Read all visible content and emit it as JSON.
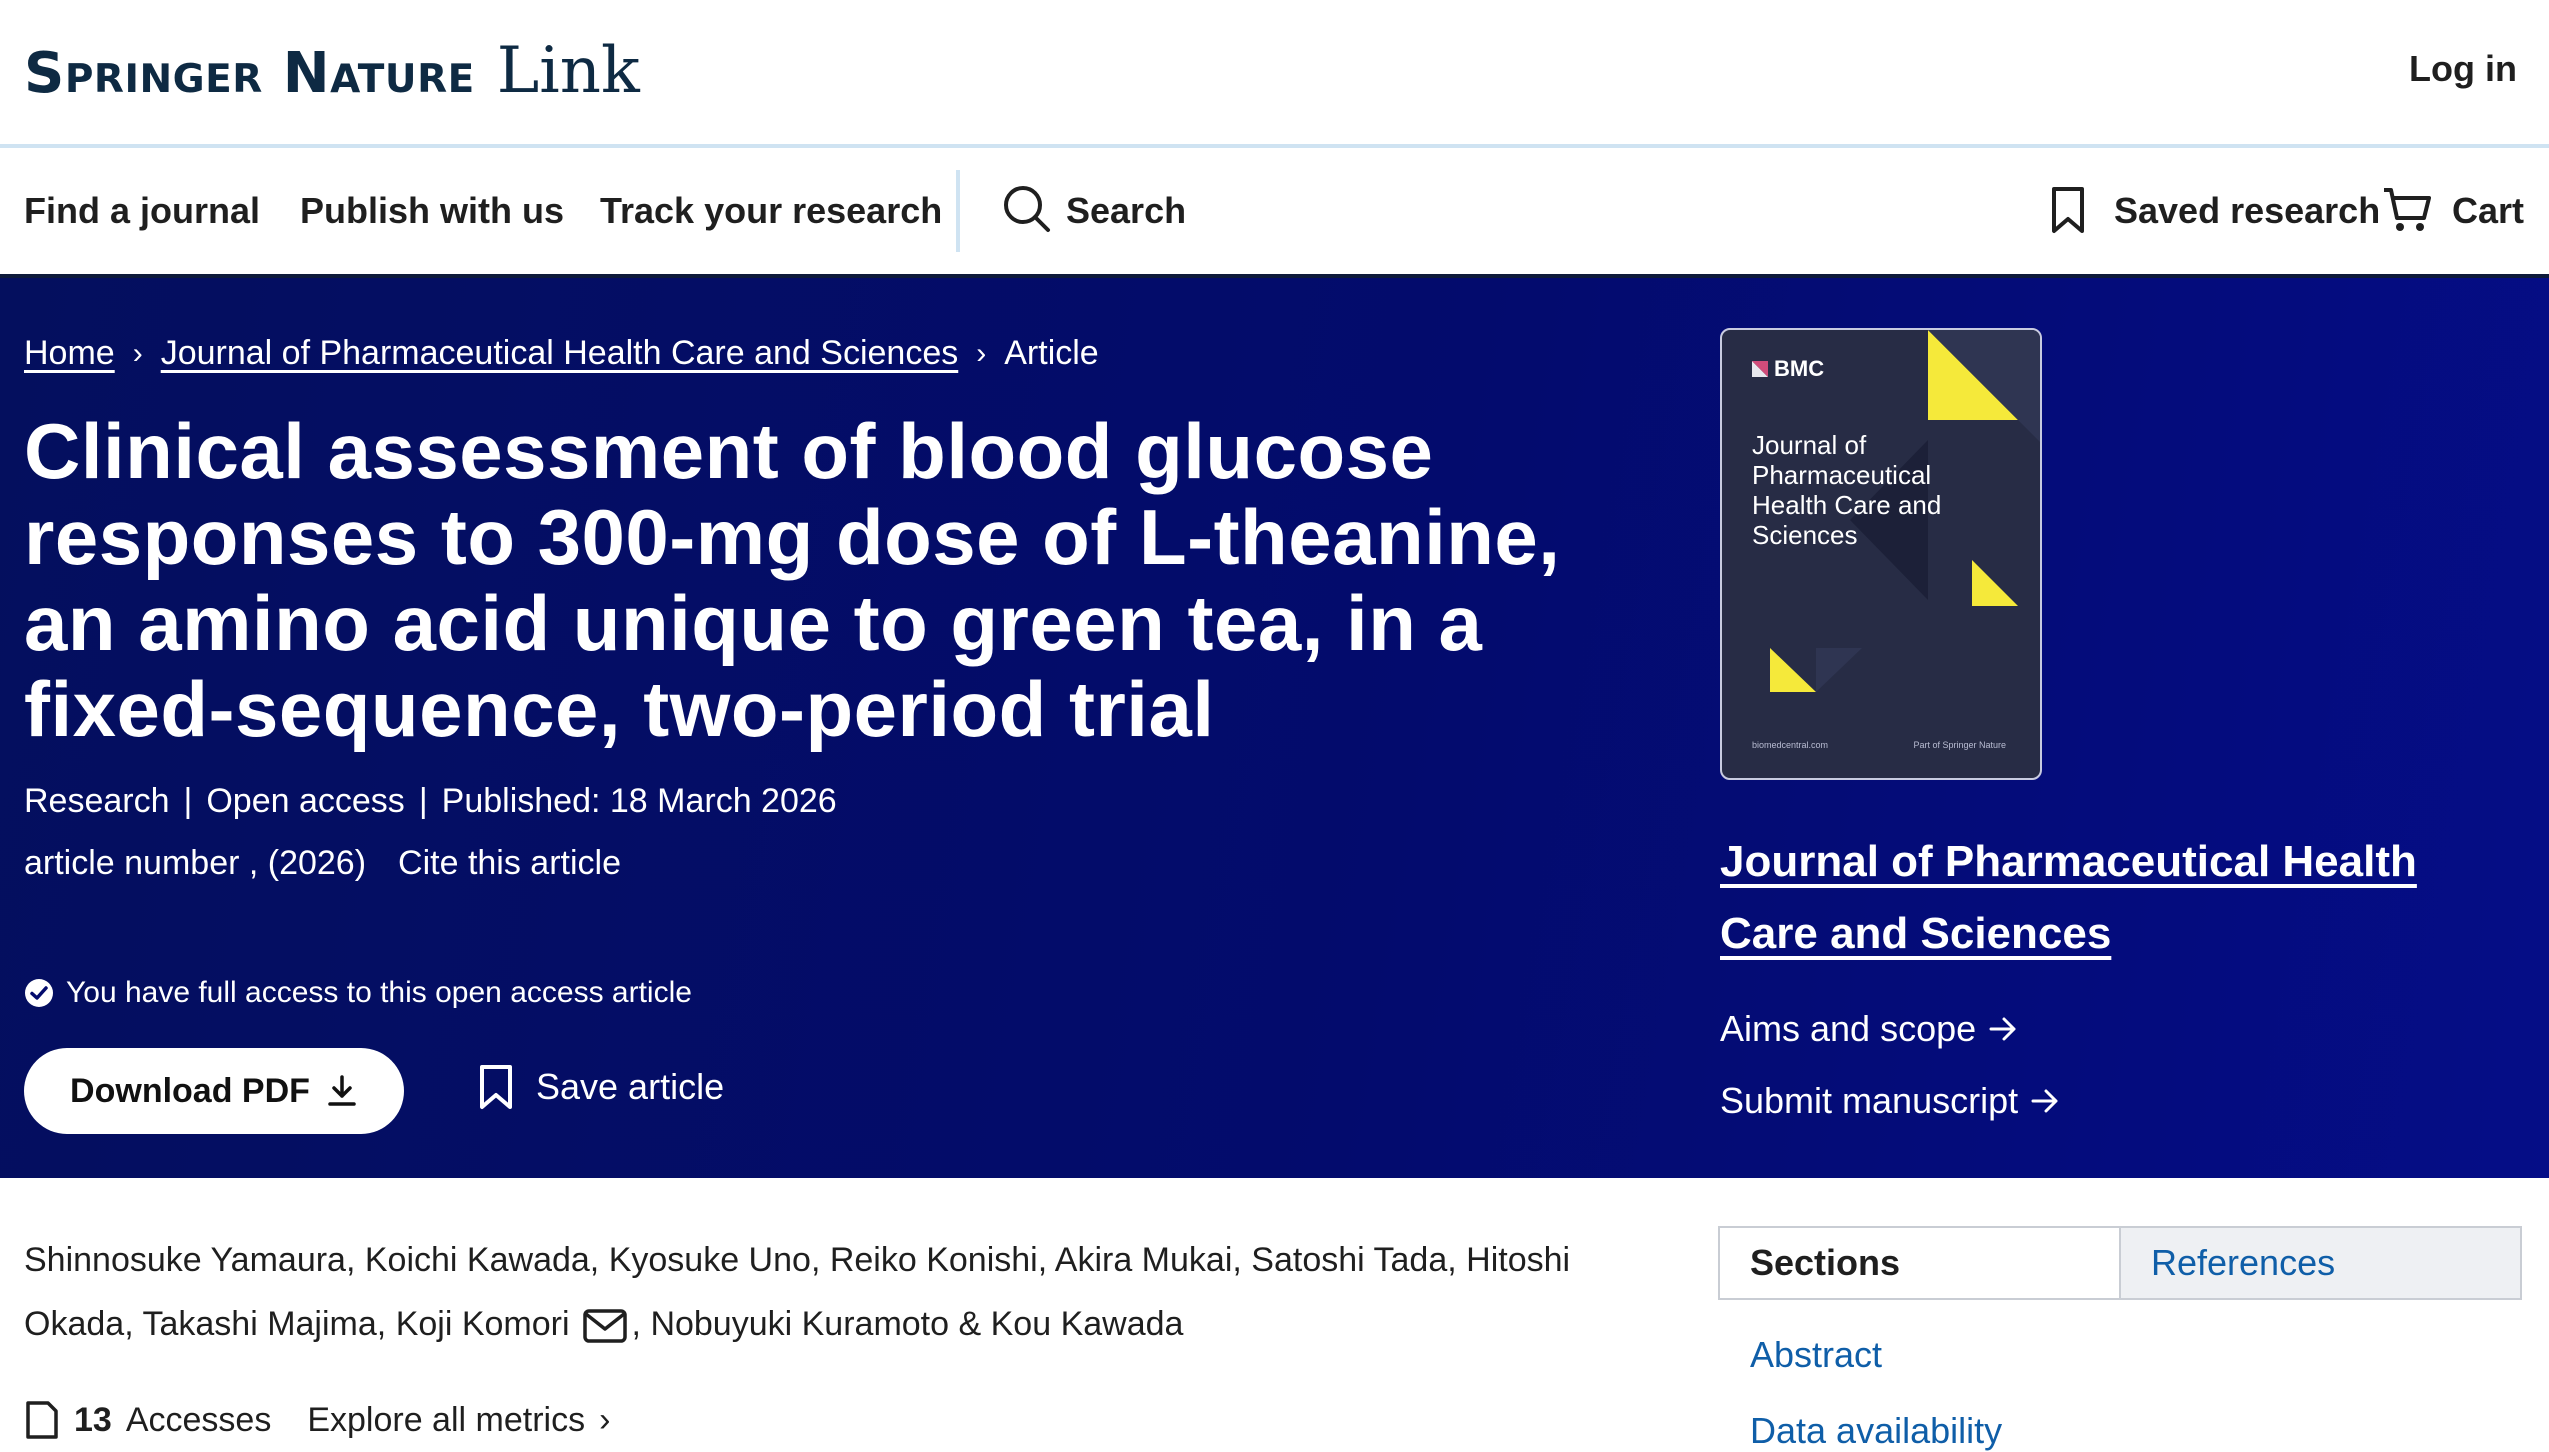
{
  "header": {
    "brand_main": "Springer Nature",
    "brand_sub": "Link",
    "login_label": "Log in"
  },
  "nav": {
    "items": [
      "Find a journal",
      "Publish with us",
      "Track your research"
    ],
    "search_label": "Search",
    "saved_label": "Saved research",
    "cart_label": "Cart"
  },
  "breadcrumb": {
    "home": "Home",
    "journal": "Journal of Pharmaceutical Health Care and Sciences",
    "current": "Article"
  },
  "article": {
    "title": "Clinical assessment of blood glucose responses to 300-mg dose of L-theanine, an amino acid unique to green tea, in a fixed-sequence, two-period trial",
    "type": "Research",
    "open_access": "Open access",
    "published": "Published: 18 March 2026",
    "article_number": "article number , (2026)",
    "cite": "Cite this article",
    "access_prefix": "You have full access to this",
    "access_link": "open access",
    "access_suffix": "article",
    "download_label": "Download PDF",
    "save_label": "Save article"
  },
  "cover": {
    "publisher": "BMC",
    "title": "Journal of Pharmaceutical Health Care and Sciences",
    "footer_left": "biomedcentral.com",
    "footer_right": "Part of Springer Nature"
  },
  "journal_panel": {
    "name": "Journal of Pharmaceutical Health Care and Sciences",
    "aims": "Aims and scope",
    "submit": "Submit manuscript"
  },
  "authors": [
    "Shinnosuke Yamaura",
    "Koichi Kawada",
    "Kyosuke Uno",
    "Reiko Konishi",
    "Akira Mukai",
    "Satoshi Tada",
    "Hitoshi Okada",
    "Takashi Majima",
    "Koji Komori",
    "Nobuyuki Kuramoto",
    "Kou Kawada"
  ],
  "metrics": {
    "accesses_count": "13",
    "accesses_label": "Accesses",
    "explore_label": "Explore all metrics"
  },
  "sidebar": {
    "tab_sections": "Sections",
    "tab_references": "References",
    "links": [
      "Abstract",
      "Data availability"
    ]
  },
  "colors": {
    "hero_bg": "#030b6d",
    "link_blue": "#0f5ea8",
    "brand_navy": "#0e2a43",
    "cover_accent": "#f5e93a"
  }
}
